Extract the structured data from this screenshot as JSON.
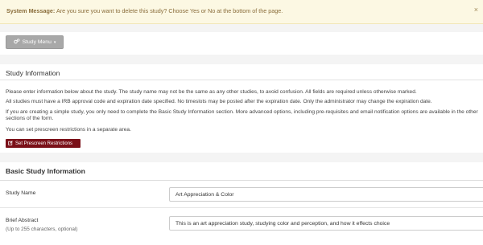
{
  "system_message": {
    "label": "System Message:",
    "text": "Are you sure you want to delete this study? Choose Yes or No at the bottom of the page.",
    "close_label": "×"
  },
  "study_menu": {
    "label": "Study Menu",
    "caret": "▾",
    "icon": "gears-icon"
  },
  "study_information": {
    "title": "Study Information",
    "paragraphs": [
      "Please enter information below about the study. The study name may not be the same as any other studies, to avoid confusion. All fields are required unless otherwise marked.",
      "All studies must have a IRB approval code and expiration date specified. No timeslots may be posted after the expiration date. Only the administrator may change the expiration date.",
      "If you are creating a simple study, you only need to complete the Basic Study Information section. More advanced options, including pre-requisites and email notification options are available in the other sections of the form.",
      "You can set prescreen restrictions in a separate area."
    ],
    "prescreen_button": "Set Prescreen Restrictions",
    "prescreen_icon": "edit-icon"
  },
  "basic_info": {
    "title": "Basic Study Information",
    "study_name_label": "Study Name",
    "study_name_value": "Art Appreciation & Color",
    "abstract_label": "Brief Abstract",
    "abstract_sublabel": "(Up to 255 characters, optional)",
    "abstract_value": "This is an art appreciation study, studying color and perception, and how it effects choice"
  },
  "colors": {
    "alert_bg": "#fcf8e3",
    "alert_text": "#8a6d3b",
    "menu_button": "#a8a8a8",
    "prescreen_button": "#7a1018"
  }
}
